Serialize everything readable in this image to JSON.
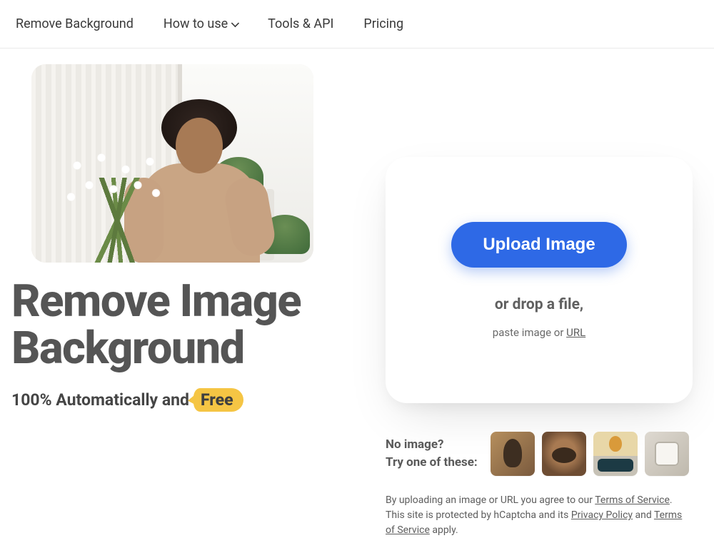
{
  "nav": {
    "items": [
      {
        "label": "Remove Background",
        "has_submenu": false
      },
      {
        "label": "How to use",
        "has_submenu": true
      },
      {
        "label": "Tools & API",
        "has_submenu": false
      },
      {
        "label": "Pricing",
        "has_submenu": false
      }
    ]
  },
  "hero": {
    "image_alt": "Smiling woman holding bouquet of daisies",
    "headline_line1": "Remove Image",
    "headline_line2": "Background",
    "subhead_prefix": "100% Automatically and",
    "subhead_badge": "Free"
  },
  "uploader": {
    "button_label": "Upload Image",
    "drop_text": "or drop a file,",
    "paste_prefix": "paste image or ",
    "paste_link": "URL"
  },
  "samples": {
    "line1": "No image?",
    "line2": "Try one of these:",
    "thumbs": [
      {
        "alt": "person-sample"
      },
      {
        "alt": "bear-sample"
      },
      {
        "alt": "car-balloon-sample"
      },
      {
        "alt": "mug-sample"
      }
    ]
  },
  "legal": {
    "prefix": "By uploading an image or URL you agree to our ",
    "tos": "Terms of Service",
    "middle": ". This site is protected by hCaptcha and its ",
    "privacy": "Privacy Policy",
    "and": " and ",
    "tos2": "Terms of Service",
    "suffix": " apply."
  }
}
